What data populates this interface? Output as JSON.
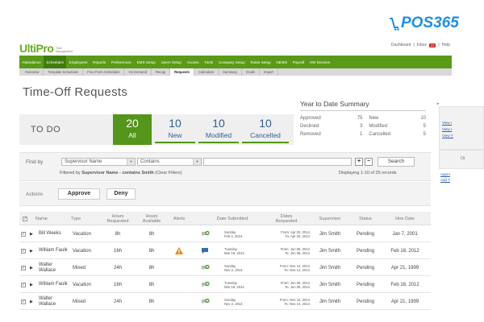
{
  "watermark": {
    "text": "POS365",
    "logo_icon": "pos365-cart-icon"
  },
  "app": {
    "brand": "UltiPro",
    "brand_sub": "Time Management"
  },
  "toplinks": {
    "dashboard": "Dashboard",
    "inbox": "Inbox",
    "inbox_count": "27",
    "help": "Help"
  },
  "mainnav": [
    {
      "label": "Attendance"
    },
    {
      "label": "Schedules",
      "active": true
    },
    {
      "label": "Employees"
    },
    {
      "label": "Reports"
    },
    {
      "label": "Preferences"
    },
    {
      "label": "EMS Setup"
    },
    {
      "label": "Users Setup"
    },
    {
      "label": "Access"
    },
    {
      "label": "Tools"
    },
    {
      "label": "Company Setup"
    },
    {
      "label": "Rules Setup"
    },
    {
      "label": "NEWS"
    },
    {
      "label": "Payroll"
    },
    {
      "label": "HW Devices"
    }
  ],
  "subnav": [
    {
      "label": "Overview"
    },
    {
      "label": "Template Schedules"
    },
    {
      "label": "Free Form Schedules"
    },
    {
      "label": "On Demand"
    },
    {
      "label": "Recap"
    },
    {
      "label": "Requests",
      "active": true
    },
    {
      "label": "Calendars"
    },
    {
      "label": "Summary"
    },
    {
      "label": "Goals"
    },
    {
      "label": "Import"
    }
  ],
  "page": {
    "title": "Time-Off Requests"
  },
  "ytd": {
    "title": "Year to Date Summary",
    "approved_label": "Approved",
    "approved": "75",
    "new_label": "New",
    "new": "10",
    "declined_label": "Declined",
    "declined": "3",
    "modified_label": "Modified",
    "modified": "5",
    "removed_label": "Removed",
    "removed": "1",
    "cancelled_label": "Cancelled",
    "cancelled": "5"
  },
  "right_panel": {
    "links": [
      "View I",
      "View I",
      "View Y"
    ],
    "box2_head": "Or",
    "links2": [
      "Appro",
      "Add T"
    ]
  },
  "todo": {
    "label": "TO DO",
    "all": {
      "count": "20",
      "label": "All"
    },
    "new": {
      "count": "10",
      "label": "New"
    },
    "modified": {
      "count": "10",
      "label": "Modified"
    },
    "cancelled": {
      "count": "10",
      "label": "Cancelled"
    }
  },
  "find": {
    "label": "Find by",
    "field": "Supervisor Name",
    "operator": "Contains",
    "value": "",
    "search_label": "Search",
    "filtered_prefix": "Filtered by ",
    "filtered_text": "Supervisor Name - contains Smith",
    "clear_filters": " (Clear Filters)",
    "display": "Displaying 1-10 of 25 records"
  },
  "actions": {
    "label": "Actions",
    "approve": "Approve",
    "deny": "Deny"
  },
  "grid": {
    "headers": {
      "name": "Name",
      "type": "Type",
      "hours_requested": "Hours Requested",
      "hours_available": "Hours Available",
      "alerts": "Alerts",
      "date_submitted": "Date Submitted",
      "dates_requested": "Dates Requested",
      "supervisor": "Supervisor",
      "status": "Status",
      "hire_date": "Hire Date"
    },
    "rows": [
      {
        "name": "Bill Weeks",
        "type": "Vacation",
        "req": "8h",
        "avail": "8h",
        "alert": "",
        "comment": false,
        "sub_day": "Sunday",
        "sub_date": "Feb 2, 2014",
        "from": "From: Apr 03, 2014",
        "to": "To: Apr 03, 2014",
        "supervisor": "Jim Smith",
        "status": "Pending",
        "hire": "Jan 7, 2001"
      },
      {
        "name": "William Faulk",
        "type": "Vacation",
        "req": "16h",
        "avail": "8h",
        "alert": "warning",
        "comment": true,
        "sub_day": "Tuesday",
        "sub_date": "Mar 18, 2014",
        "from": "From: Jun 05, 2014",
        "to": "To: Jun 06, 2014",
        "supervisor": "Jim Smith",
        "status": "Pending",
        "hire": "Feb 18, 2012"
      },
      {
        "name": "Walter Wallace",
        "type": "Mixed",
        "req": "24h",
        "avail": "8h",
        "alert": "",
        "comment": false,
        "sub_day": "Sunday",
        "sub_date": "Nov 2, 2014",
        "from": "From: Nov 12, 2014",
        "to": "To: Nov 14, 2014",
        "supervisor": "Jim Smith",
        "status": "Pending",
        "hire": "Apr 21, 1999"
      },
      {
        "name": "William Faulk",
        "type": "Vacation",
        "req": "16h",
        "avail": "8h",
        "alert": "",
        "comment": false,
        "sub_day": "Tuesday",
        "sub_date": "Mar 18, 2014",
        "from": "From: Jun 05, 2014",
        "to": "To: Jun 06, 2014",
        "supervisor": "Jim Smith",
        "status": "Pending",
        "hire": "Feb 18, 2012"
      },
      {
        "name": "Walter Wallace",
        "type": "Mixed",
        "req": "24h",
        "avail": "8h",
        "alert": "",
        "comment": false,
        "sub_day": "Sunday",
        "sub_date": "Nov 2, 2014",
        "from": "From: Nov 12, 2014",
        "to": "To: Nov 14, 2014",
        "supervisor": "Jim Smith",
        "status": "Pending",
        "hire": "Apr 21, 1999"
      }
    ]
  },
  "colors": {
    "nav_green": "#5a9a19",
    "tile_green": "#53961a",
    "link_blue": "#2f5f94",
    "warning": "#e8891c",
    "logo_blue": "#1f8fe6"
  }
}
